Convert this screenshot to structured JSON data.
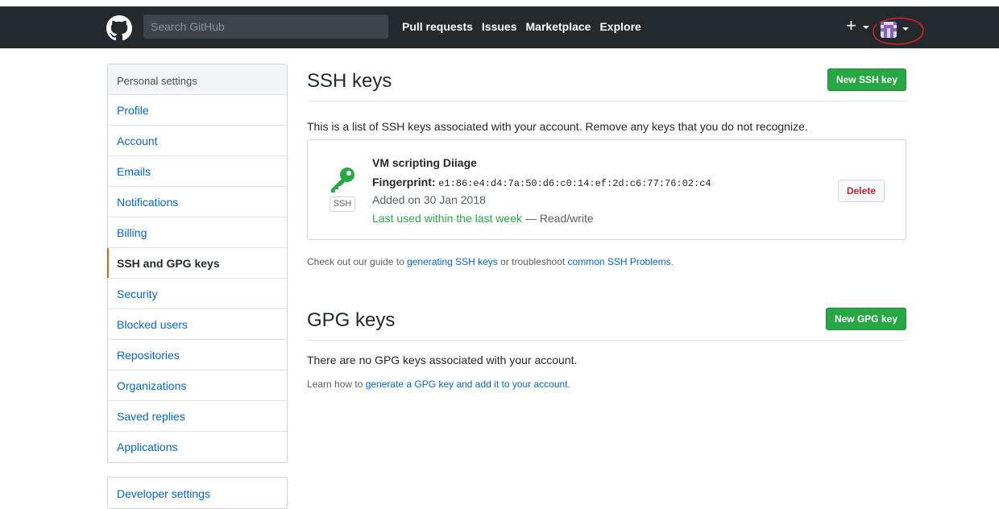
{
  "header": {
    "search_placeholder": "Search GitHub",
    "nav": [
      "Pull requests",
      "Issues",
      "Marketplace",
      "Explore"
    ],
    "plus": "+",
    "annotation_color": "#e0201c"
  },
  "sidebar": {
    "title": "Personal settings",
    "items": [
      {
        "label": "Profile"
      },
      {
        "label": "Account"
      },
      {
        "label": "Emails"
      },
      {
        "label": "Notifications"
      },
      {
        "label": "Billing"
      },
      {
        "label": "SSH and GPG keys",
        "selected": true
      },
      {
        "label": "Security"
      },
      {
        "label": "Blocked users"
      },
      {
        "label": "Repositories"
      },
      {
        "label": "Organizations"
      },
      {
        "label": "Saved replies"
      },
      {
        "label": "Applications"
      }
    ],
    "developer": "Developer settings"
  },
  "ssh": {
    "title": "SSH keys",
    "new_button": "New SSH key",
    "intro": "This is a list of SSH keys associated with your account. Remove any keys that you do not recognize.",
    "key": {
      "name": "VM scripting Diiage",
      "fp_label": "Fingerprint:",
      "fingerprint": "e1:86:e4:d4:7a:50:d6:c0:14:ef:2d:c6:77:76:02:c4",
      "added": "Added on 30 Jan 2018",
      "used": "Last used within the last week",
      "access": " — Read/write",
      "type": "SSH",
      "delete": "Delete",
      "icon_color": "#28a745"
    },
    "help_prefix": "Check out our guide to ",
    "help_link1": "generating SSH keys",
    "help_mid": " or troubleshoot ",
    "help_link2": "common SSH Problems",
    "help_suffix": "."
  },
  "gpg": {
    "title": "GPG keys",
    "new_button": "New GPG key",
    "none": "There are no GPG keys associated with your account.",
    "learn_prefix": "Learn how to ",
    "learn_link": "generate a GPG key and add it to your account",
    "learn_suffix": "."
  }
}
